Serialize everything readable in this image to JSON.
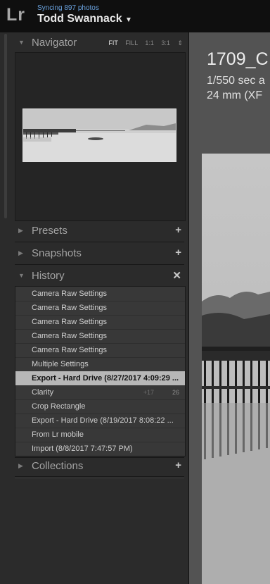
{
  "app": {
    "logo": "Lr",
    "sync_status": "Syncing 897 photos",
    "user_name": "Todd Swannack",
    "user_caret": "▼"
  },
  "navigator": {
    "title": "Navigator",
    "zoom_options": [
      "FIT",
      "FILL",
      "1:1",
      "3:1",
      "⇕"
    ],
    "selected_zoom": "FIT"
  },
  "presets": {
    "title": "Presets",
    "action": "+"
  },
  "snapshots": {
    "title": "Snapshots",
    "action": "+"
  },
  "history": {
    "title": "History",
    "action": "✕",
    "items": [
      {
        "label": "Camera Raw Settings"
      },
      {
        "label": "Camera Raw Settings"
      },
      {
        "label": "Camera Raw Settings"
      },
      {
        "label": "Camera Raw Settings"
      },
      {
        "label": "Camera Raw Settings"
      },
      {
        "label": "Multiple Settings"
      },
      {
        "label": "Export - Hard Drive (8/27/2017 4:09:29 ...",
        "selected": true
      },
      {
        "label": "Clarity",
        "value1": "+17",
        "value2": "26"
      },
      {
        "label": "Crop Rectangle"
      },
      {
        "label": "Export - Hard Drive (8/19/2017 8:08:22 ..."
      },
      {
        "label": "From Lr mobile"
      },
      {
        "label": "Import (8/8/2017 7:47:57 PM)"
      }
    ]
  },
  "collections": {
    "title": "Collections",
    "action": "+"
  },
  "photo_info": {
    "title": "1709_C",
    "line1": "1/550 sec a",
    "line2": "24 mm (XF"
  },
  "icons": {
    "collapsed": "triangle-right",
    "expanded": "triangle-down"
  },
  "colors": {
    "sync_accent": "#6aa2de",
    "selected_row": "#b7b7b7",
    "panel_bg": "#2b2b2b",
    "main_bg": "#535353"
  }
}
